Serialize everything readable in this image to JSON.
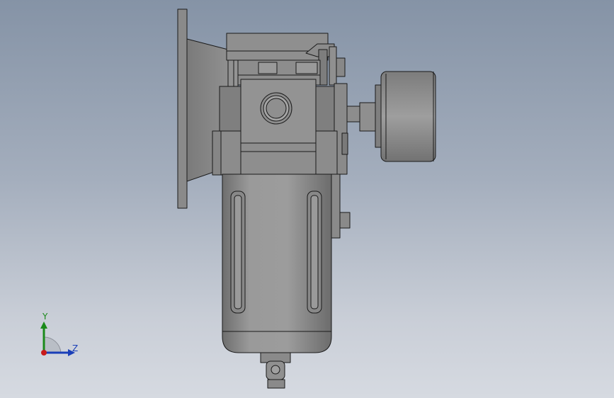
{
  "triad": {
    "y_label": "Y",
    "z_label": "Z",
    "colors": {
      "y": "#1a8a1a",
      "z": "#1a3fb8",
      "x": "#c81a1a"
    }
  },
  "model": {
    "name": "filter-regulator-with-gauge",
    "body_color": "#8a8a8a",
    "edge_color": "#1a1a1a"
  }
}
